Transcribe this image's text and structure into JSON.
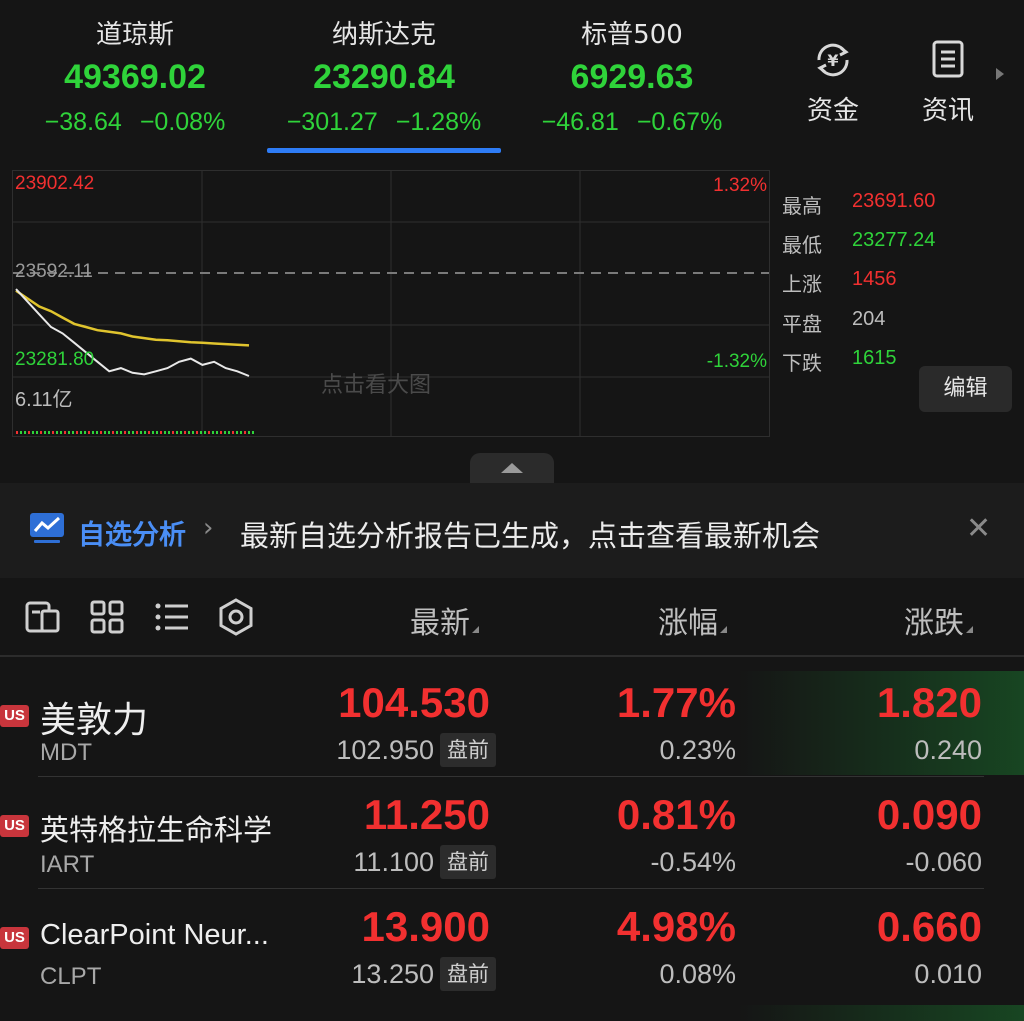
{
  "indices": [
    {
      "name": "道琼斯",
      "price": "49369.02",
      "change": "−38.64",
      "pct": "−0.08%"
    },
    {
      "name": "纳斯达克",
      "price": "23290.84",
      "change": "−301.27",
      "pct": "−1.28%"
    },
    {
      "name": "标普500",
      "price": "6929.63",
      "change": "−46.81",
      "pct": "−0.67%"
    }
  ],
  "top_buttons": {
    "funds": "资金",
    "news": "资讯"
  },
  "chart": {
    "high_label": "23902.42",
    "prev_close_label": "23592.11",
    "low_label": "23281.80",
    "pct_top": "1.32%",
    "pct_bottom": "-1.32%",
    "volume_label": "6.11亿",
    "watermark": "点击看大图"
  },
  "chart_data": {
    "type": "line",
    "ylim": [
      23281.8,
      23902.42
    ],
    "reference": 23592.11,
    "series": [
      {
        "values": [
          23555,
          23530,
          23505,
          23490,
          23470,
          23450,
          23440,
          23430,
          23425,
          23420,
          23410,
          23405,
          23400,
          23398,
          23395,
          23392,
          23390,
          23388,
          23386,
          23384,
          23382
        ]
      },
      {
        "values": [
          23560,
          23520,
          23480,
          23440,
          23420,
          23390,
          23360,
          23330,
          23300,
          23310,
          23295,
          23290,
          23300,
          23310,
          23330,
          23340,
          23320,
          23330,
          23310,
          23300,
          23285
        ]
      }
    ]
  },
  "stats": [
    {
      "key": "最高",
      "value": "23691.60",
      "color": "#f23030"
    },
    {
      "key": "最低",
      "value": "23277.24",
      "color": "#2fd33a"
    },
    {
      "key": "上涨",
      "value": "1456",
      "color": "#f23030"
    },
    {
      "key": "平盘",
      "value": "204",
      "color": "#bdbdbd"
    },
    {
      "key": "下跌",
      "value": "1615",
      "color": "#2fd33a"
    }
  ],
  "edit_label": "编辑",
  "banner": {
    "title": "自选分析",
    "message": "最新自选分析报告已生成，点击查看最新机会"
  },
  "columns": {
    "latest": "最新",
    "change_pct": "涨幅",
    "change": "涨跌"
  },
  "stocks": [
    {
      "market": "US",
      "name": "美敦力",
      "code": "MDT",
      "price": "104.530",
      "pct": "1.77%",
      "change": "1.820",
      "pre_price": "102.950",
      "pre_label": "盘前",
      "pre_pct": "0.23%",
      "pre_change": "0.240"
    },
    {
      "market": "US",
      "name": "英特格拉生命科学",
      "code": "IART",
      "price": "11.250",
      "pct": "0.81%",
      "change": "0.090",
      "pre_price": "11.100",
      "pre_label": "盘前",
      "pre_pct": "-0.54%",
      "pre_change": "-0.060"
    },
    {
      "market": "US",
      "name": "ClearPoint Neur...",
      "code": "CLPT",
      "price": "13.900",
      "pct": "4.98%",
      "change": "0.660",
      "pre_price": "13.250",
      "pre_label": "盘前",
      "pre_pct": "0.08%",
      "pre_change": "0.010"
    }
  ]
}
